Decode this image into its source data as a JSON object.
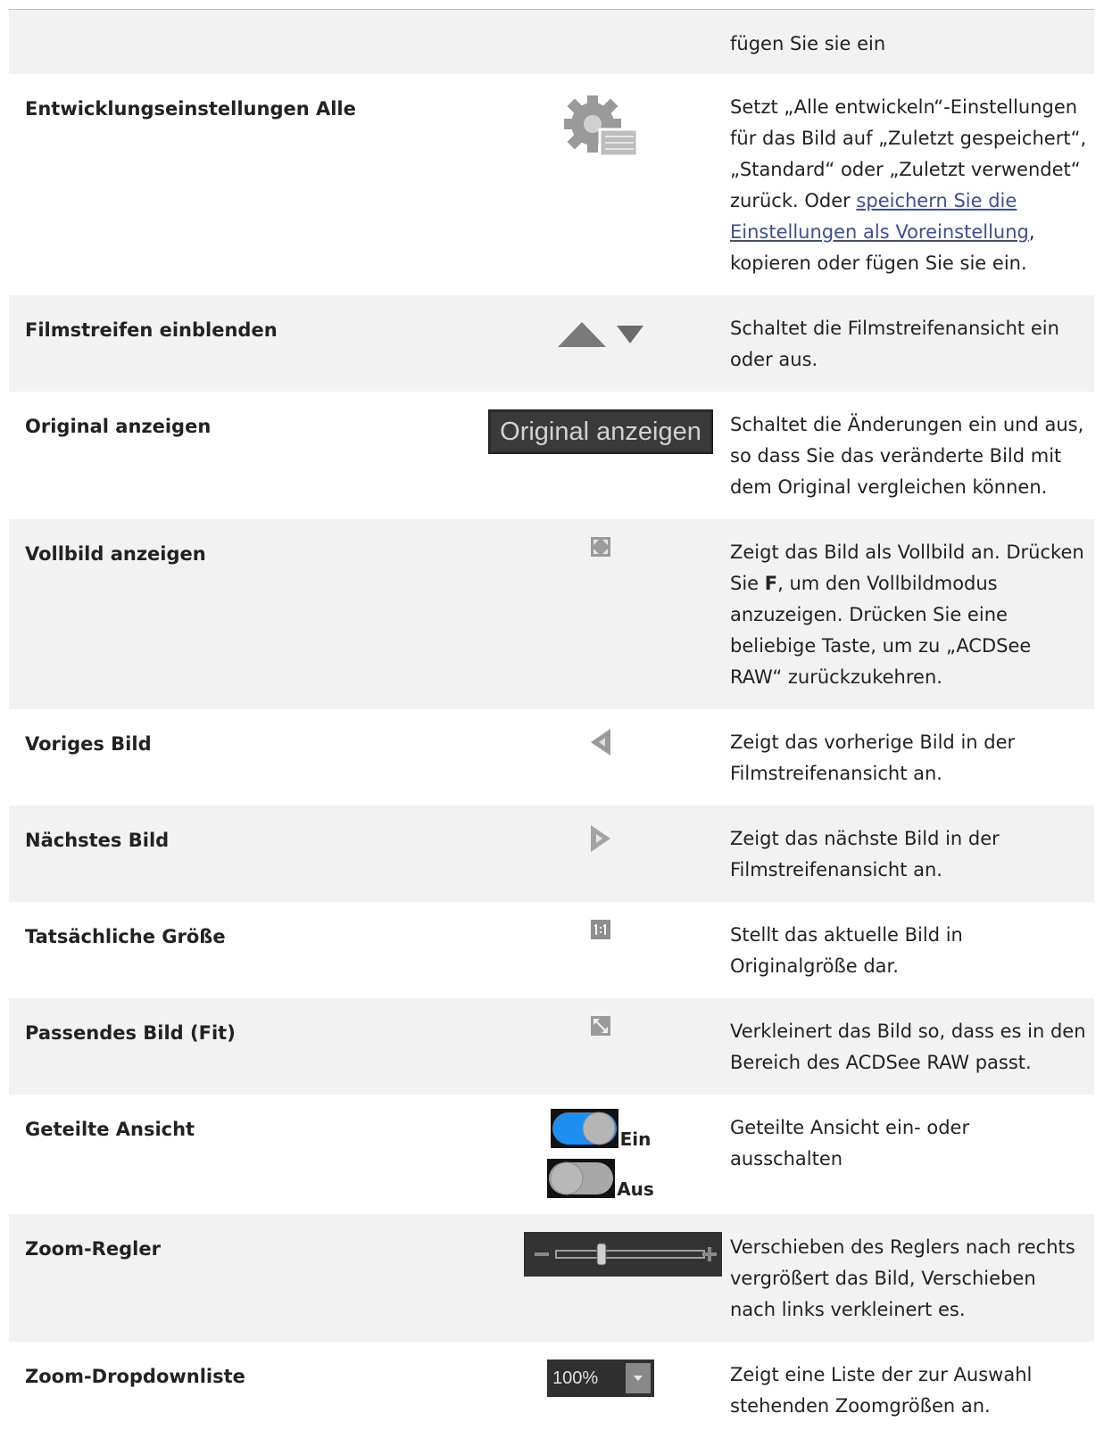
{
  "rows": [
    {
      "name": "",
      "desc": "fügen Sie sie ein"
    },
    {
      "name": "Entwicklungseinstellungen Alle",
      "desc_a": "Setzt „Alle entwickeln“-Einstellungen für das Bild auf „Zuletzt gespeichert“, „Standard“ oder „Zuletzt verwendet“ zurück. Oder ",
      "desc_link": "speichern Sie die Einstellungen als Voreinstellung",
      "desc_b": ", kopieren oder fügen Sie sie ein.",
      "icon": "gear-settings-icon"
    },
    {
      "name": "Filmstreifen einblenden",
      "desc": "Schaltet die Filmstreifenansicht ein oder aus.",
      "icon": "triangle-up-down-icon"
    },
    {
      "name": "Original anzeigen",
      "button_label": "Original anzeigen",
      "desc": "Schaltet die Änderungen ein und aus, so dass Sie das veränderte Bild mit dem Original vergleichen können."
    },
    {
      "name": "Vollbild anzeigen",
      "desc_a": "Zeigt das Bild als Vollbild an. Drücken Sie ",
      "desc_key": "F",
      "desc_b": ", um den Vollbildmodus anzuzeigen. Drücken Sie eine beliebige Taste, um zu „ACDSee RAW“ zurückzukehren.",
      "icon": "fullscreen-icon"
    },
    {
      "name": "Voriges Bild",
      "desc": "Zeigt das vorherige Bild in der Filmstreifenansicht an.",
      "icon": "previous-arrow-icon"
    },
    {
      "name": "Nächstes Bild",
      "desc": "Zeigt das nächste Bild in der Filmstreifenansicht an.",
      "icon": "next-arrow-icon"
    },
    {
      "name": "Tatsächliche Größe",
      "desc": "Stellt das aktuelle Bild in Originalgröße dar.",
      "icon": "actual-size-icon"
    },
    {
      "name": "Passendes Bild (Fit)",
      "desc": "Verkleinert das Bild so, dass es in den Bereich des ACDSee RAW passt.",
      "icon": "fit-image-icon"
    },
    {
      "name": "Geteilte Ansicht",
      "toggle_on": "Ein",
      "toggle_off": "Aus",
      "desc": "Geteilte Ansicht ein- oder ausschalten"
    },
    {
      "name": "Zoom-Regler",
      "desc": "Verschieben des Reglers nach rechts vergrößert das Bild, Verschieben nach links verkleinert es.",
      "icon": "zoom-slider-icon"
    },
    {
      "name": "Zoom-Dropdownliste",
      "zoom_value": "100%",
      "desc": "Zeigt eine Liste der zur Auswahl stehenden Zoomgrößen an."
    }
  ],
  "colors": {
    "link": "#3a4ea0",
    "toggle_on": "#1e8ff0",
    "row_shade": "#f2f2f2"
  }
}
